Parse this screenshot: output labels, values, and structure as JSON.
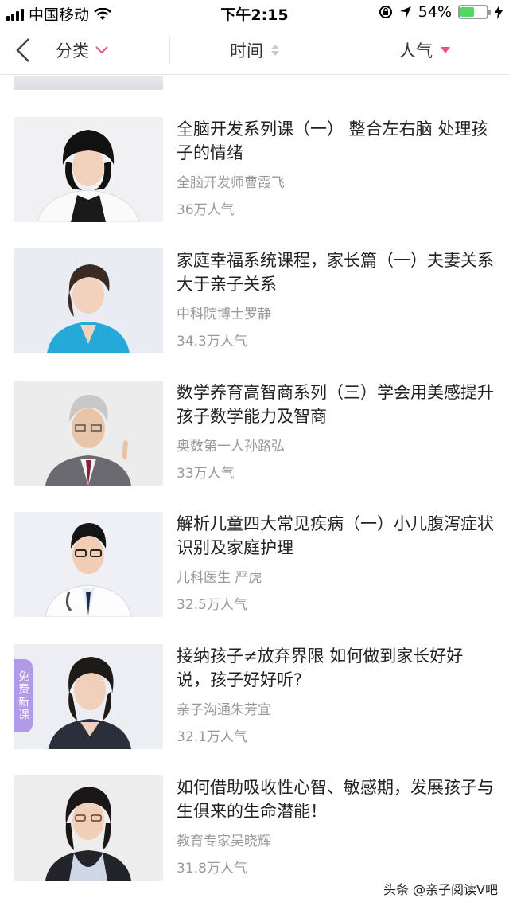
{
  "status_bar": {
    "carrier": "中国移动",
    "time": "下午2:15",
    "battery_percent": "54%",
    "battery_level": 0.54,
    "icons": [
      "signal-icon",
      "wifi-icon",
      "orientation-lock-icon",
      "location-icon",
      "battery-icon",
      "charging-icon"
    ]
  },
  "filter_bar": {
    "back_icon": "chevron-left-icon",
    "category_label": "分类",
    "time_label": "时间",
    "popular_label": "人气",
    "accent_color": "#e8527a"
  },
  "courses": [
    {
      "title": "全脑开发系列课（一） 整合左右脑 处理孩子的情绪",
      "author": "全脑开发师曹霞飞",
      "popularity": "36万人气"
    },
    {
      "title": "家庭幸福系统课程，家长篇（一）夫妻关系大于亲子关系",
      "author": "中科院博士罗静",
      "popularity": "34.3万人气"
    },
    {
      "title": "数学养育高智商系列（三）学会用美感提升孩子数学能力及智商",
      "author": "奥数第一人孙路弘",
      "popularity": "33万人气"
    },
    {
      "title": "解析儿童四大常见疾病（一）小儿腹泻症状识别及家庭护理",
      "author": "儿科医生 严虎",
      "popularity": "32.5万人气"
    },
    {
      "title": "接纳孩子≠放弃界限 如何做到家长好好说，孩子好好听?",
      "author": "亲子沟通朱芳宜",
      "popularity": "32.1万人气",
      "badge": "免费新课"
    },
    {
      "title": "如何借助吸收性心智、敏感期，发展孩子与生俱来的生命潜能！",
      "author": "教育专家吴晓辉",
      "popularity": "31.8万人气"
    }
  ],
  "watermark": "头条 @亲子阅读V吧"
}
